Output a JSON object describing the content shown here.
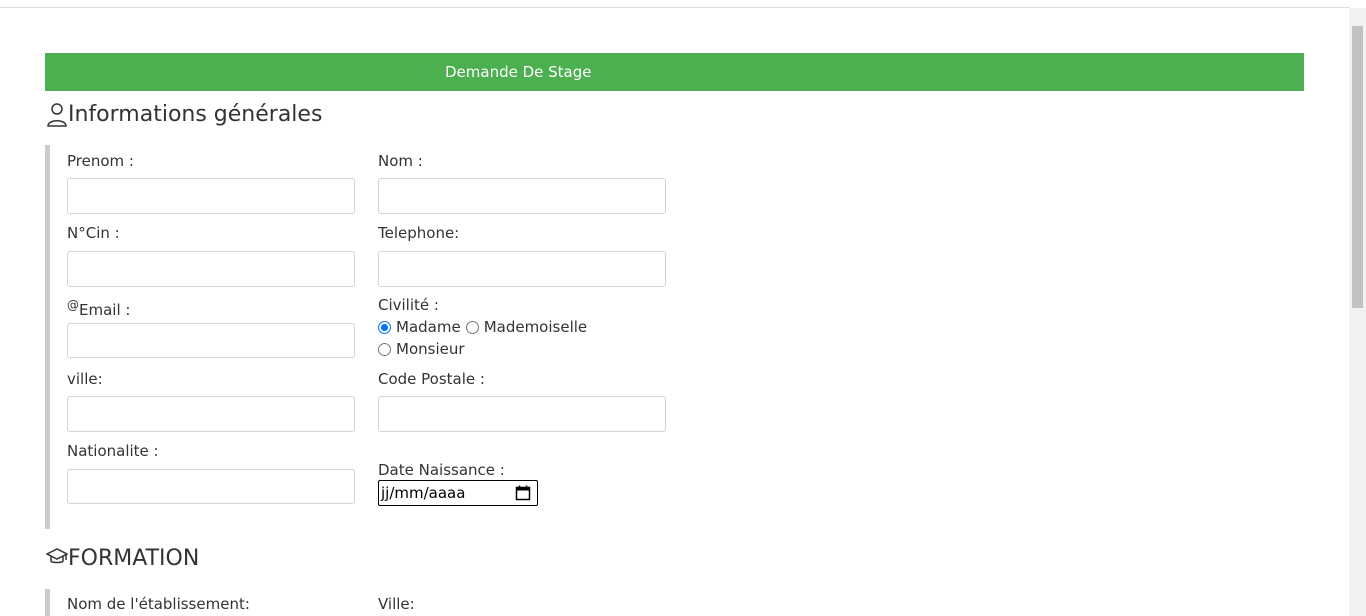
{
  "banner": {
    "title": "Demande De Stage"
  },
  "sections": {
    "general": {
      "title": "Informations générales",
      "icon": "user-icon"
    },
    "formation": {
      "title": "FORMATION",
      "icon": "graduation-cap-icon"
    }
  },
  "fields": {
    "prenom": "Prenom :",
    "nom": "Nom :",
    "cin": "N°Cin :",
    "telephone": "Telephone:",
    "email": "Email :",
    "email_symbol": "@",
    "civilite": "Civilité :",
    "ville": "ville:",
    "code_postal": "Code Postale :",
    "nationalite": "Nationalite :",
    "date_naissance": "Date Naissance :",
    "date_value": "jj/mm/aaaa",
    "etablissement": "Nom de l'établissement:",
    "formation_ville": "Ville:"
  },
  "civilite_options": {
    "madame": "Madame",
    "mademoiselle": "Mademoiselle",
    "monsieur": "Monsieur",
    "selected": "Madame"
  },
  "colors": {
    "banner": "#4caf50",
    "radio_accent": "#0075ff"
  }
}
